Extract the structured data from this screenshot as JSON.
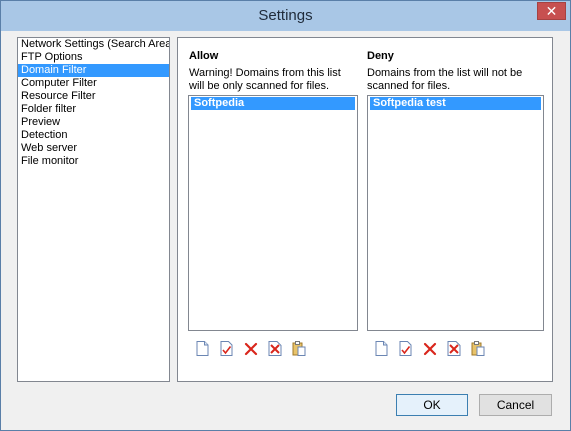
{
  "window": {
    "title": "Settings",
    "close_glyph": "✕"
  },
  "sidebar": {
    "items": [
      {
        "label": "Network Settings (Search Area",
        "selected": false
      },
      {
        "label": "FTP Options",
        "selected": false
      },
      {
        "label": "Domain Filter",
        "selected": true
      },
      {
        "label": "Computer Filter",
        "selected": false
      },
      {
        "label": "Resource Filter",
        "selected": false
      },
      {
        "label": "Folder filter",
        "selected": false
      },
      {
        "label": "Preview",
        "selected": false
      },
      {
        "label": "Detection",
        "selected": false
      },
      {
        "label": "Web server",
        "selected": false
      },
      {
        "label": "File monitor",
        "selected": false
      }
    ]
  },
  "allow": {
    "title": "Allow",
    "desc_line1": "Warning! Domains from this list",
    "desc_line2": "will be only scanned for files.",
    "items": [
      "Softpedia"
    ]
  },
  "deny": {
    "title": "Deny",
    "desc_line1": "Domains from the list will not be",
    "desc_line2": "scanned for files.",
    "items": [
      "Softpedia test"
    ]
  },
  "toolbar_icons": [
    "new-document-icon",
    "edit-document-icon",
    "delete-icon",
    "delete-all-icon",
    "paste-icon"
  ],
  "buttons": {
    "ok": "OK",
    "cancel": "Cancel"
  },
  "colors": {
    "selection": "#3399ff",
    "titlebar": "#a9c7e6",
    "close": "#c75050",
    "delete_red": "#d9261c"
  }
}
